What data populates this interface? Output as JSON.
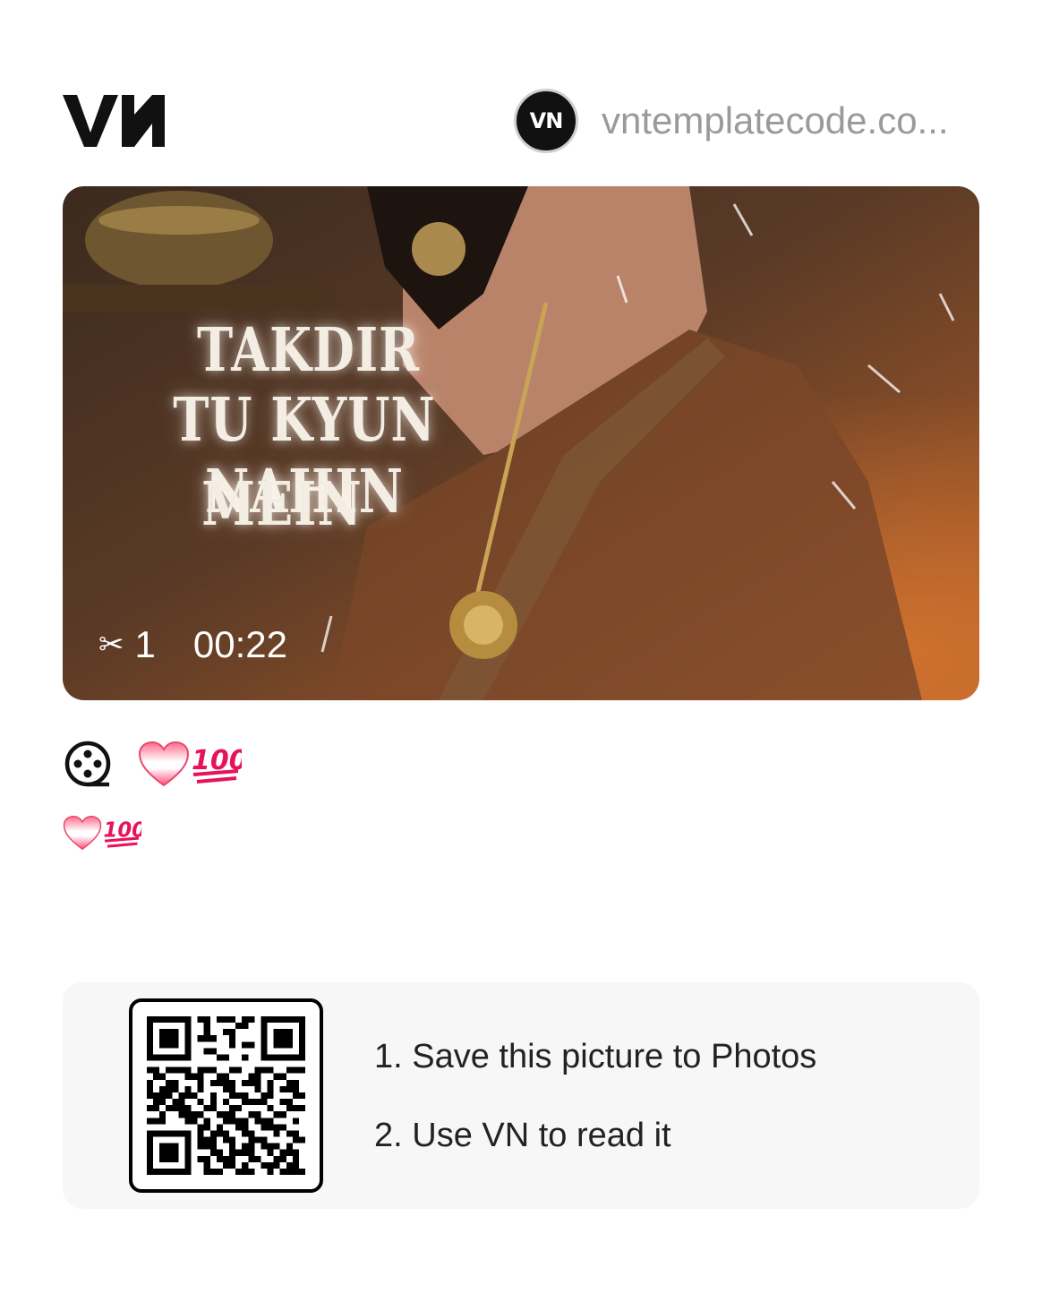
{
  "header": {
    "logo_text": "VN",
    "author_avatar_text": "VN",
    "author_name": "vntemplatecode.co..."
  },
  "thumbnail": {
    "title_lines": [
      "TAKDIR",
      "TU KYUN NAHIN",
      "MEIN"
    ],
    "clip_count": "1",
    "duration": "00:22",
    "scissors_icon": "scissors-icon"
  },
  "description": {
    "line1_emojis": [
      "heart-icon",
      "hundred-points-icon"
    ],
    "line2_emojis": [
      "heart-icon",
      "hundred-points-icon"
    ]
  },
  "qr_panel": {
    "step1": "1. Save this picture to Photos",
    "step2": "2. Use VN to read it"
  }
}
